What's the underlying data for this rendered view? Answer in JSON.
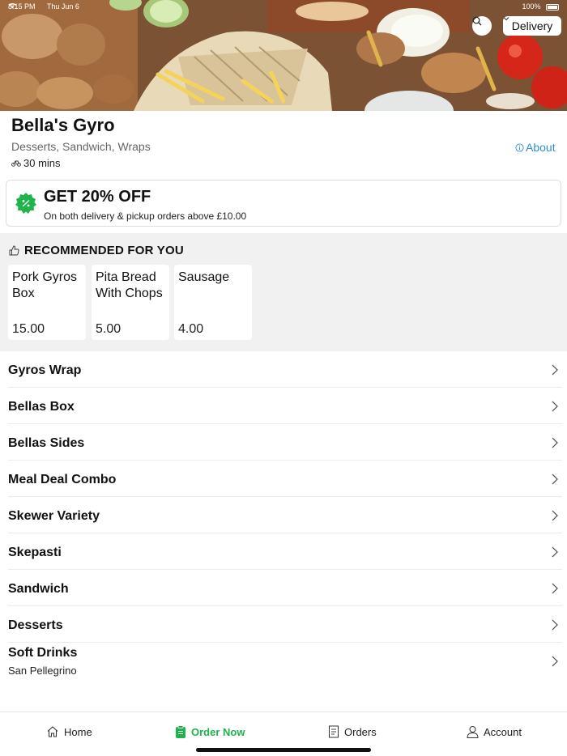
{
  "status_bar": {
    "time": "8:15 PM",
    "date": "Thu Jun 6",
    "battery": "100%"
  },
  "header": {
    "delivery_mode": "Delivery"
  },
  "restaurant": {
    "name": "Bella's Gyro",
    "cuisines": "Desserts, Sandwich, Wraps",
    "eta": "30 mins",
    "about_label": "About"
  },
  "promo": {
    "title": "GET 20% OFF",
    "subtitle": "On both delivery & pickup orders above £10.00",
    "badge_color": "#1fb34b"
  },
  "recommended": {
    "heading": "RECOMMENDED FOR YOU",
    "items": [
      {
        "name": "Pork Gyros Box",
        "price": "15.00"
      },
      {
        "name": "Pita Bread With Chops",
        "price": "5.00"
      },
      {
        "name": "Sausage",
        "price": "4.00"
      }
    ]
  },
  "menu": {
    "categories": [
      {
        "label": "Gyros Wrap"
      },
      {
        "label": "Bellas Box"
      },
      {
        "label": "Bellas Sides"
      },
      {
        "label": "Meal Deal Combo"
      },
      {
        "label": "Skewer Variety"
      },
      {
        "label": "Skepasti"
      },
      {
        "label": "Sandwich"
      },
      {
        "label": "Desserts"
      },
      {
        "label": "Soft Drinks",
        "sub": "San Pellegrino"
      }
    ]
  },
  "nav": {
    "items": [
      {
        "label": "Home",
        "icon": "home-icon"
      },
      {
        "label": "Order Now",
        "icon": "order-icon",
        "active": true
      },
      {
        "label": "Orders",
        "icon": "receipt-icon"
      },
      {
        "label": "Account",
        "icon": "person-icon"
      }
    ],
    "accent_color": "#1fb34b"
  }
}
